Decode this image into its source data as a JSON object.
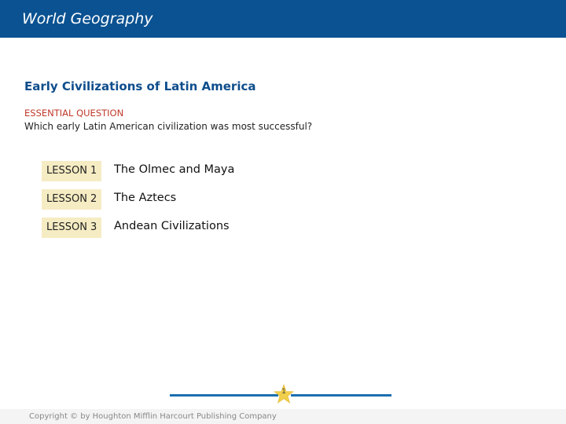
{
  "header": {
    "title": "World Geography"
  },
  "slide": {
    "title": "Early Civilizations of Latin America",
    "essential_question_label": "ESSENTIAL QUESTION",
    "essential_question": "Which early Latin American civilization was most successful?"
  },
  "lessons": [
    {
      "label": "LESSON 1",
      "title": "The Olmec and Maya"
    },
    {
      "label": "LESSON 2",
      "title": "The Aztecs"
    },
    {
      "label": "LESSON 3",
      "title": "Andean Civilizations"
    }
  ],
  "footer": {
    "page_number": "1",
    "copyright": "Copyright © by Houghton Mifflin Harcourt Publishing Company"
  },
  "colors": {
    "header_bg": "#0a5291",
    "title": "#0e4d8c",
    "eq_label": "#c0392b",
    "lesson_badge_bg": "#f6ecc3",
    "rule": "#1a6fb0",
    "star": "#f2cf4a"
  },
  "icons": {
    "page_marker": "star-icon"
  }
}
